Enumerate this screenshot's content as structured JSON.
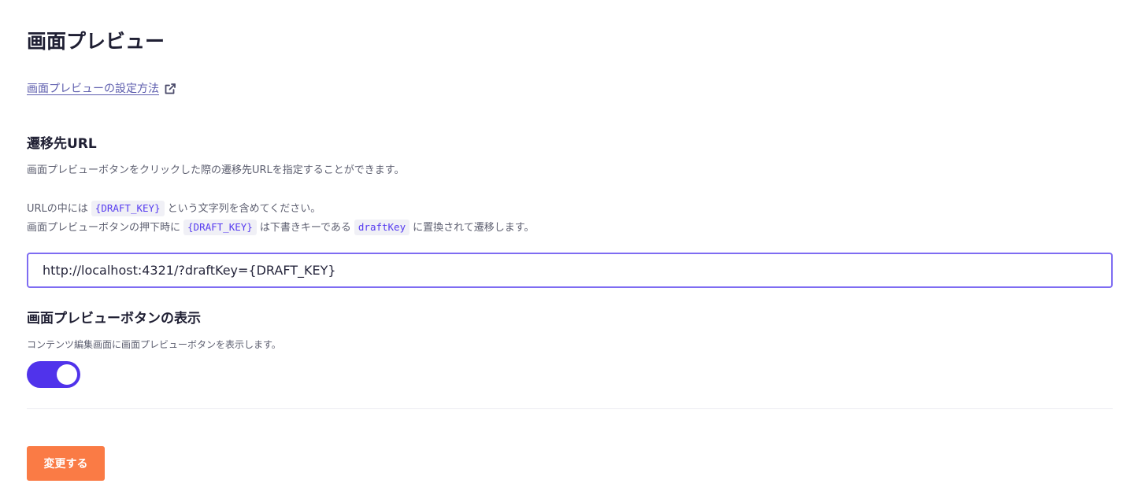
{
  "page": {
    "title": "画面プレビュー",
    "help_link": {
      "label": "画面プレビューの設定方法",
      "icon": "external-link-icon"
    }
  },
  "redirect_url": {
    "heading": "遷移先URL",
    "description": "画面プレビューボタンをクリックした際の遷移先URLを指定することができます。",
    "note_line1": {
      "before": "URLの中には",
      "code": "{DRAFT_KEY}",
      "after": "という文字列を含めてください。"
    },
    "note_line2": {
      "before": "画面プレビューボタンの押下時に",
      "code1": "{DRAFT_KEY}",
      "middle": "は下書きキーである",
      "code2": "draftKey",
      "after": "に置換されて遷移します。"
    },
    "input_value": "http://localhost:4321/?draftKey={DRAFT_KEY}"
  },
  "preview_button_display": {
    "heading": "画面プレビューボタンの表示",
    "description": "コンテンツ編集画面に画面プレビューボタンを表示します。",
    "enabled": true
  },
  "submit": {
    "label": "変更する"
  },
  "colors": {
    "accent": "#5033eb",
    "input_border": "#7e6cf2",
    "link": "#5c5cad",
    "code_text": "#563bf0",
    "submit_bg": "#fa7b45"
  }
}
